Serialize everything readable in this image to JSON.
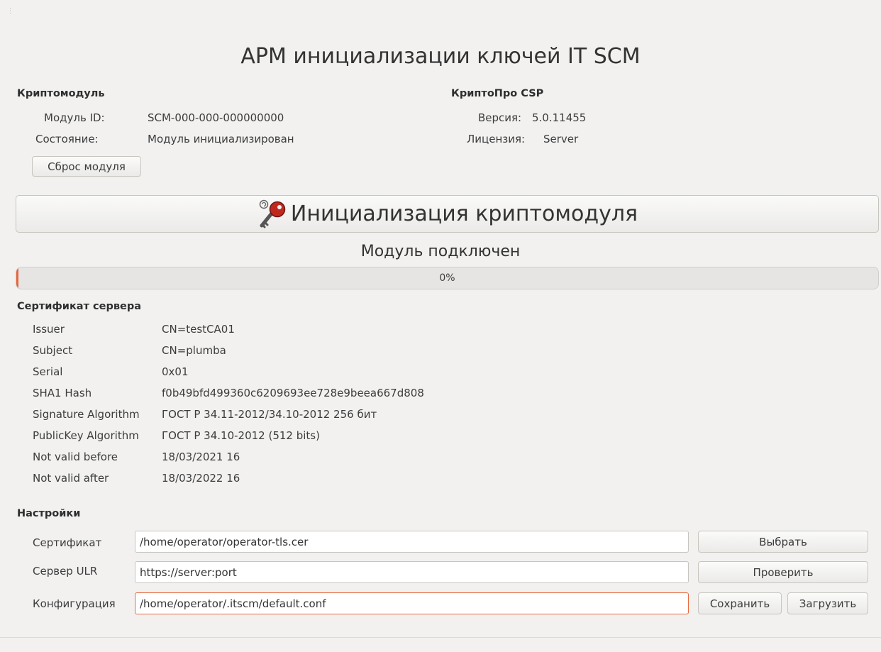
{
  "app": {
    "title": "АРМ инициализации ключей IT SCM"
  },
  "cryptomodule": {
    "heading": "Криптомодуль",
    "module_id_label": "Модуль ID:",
    "module_id_value": "SCM-000-000-000000000",
    "state_label": "Состояние:",
    "state_value": "Модуль инициализирован",
    "reset_button": "Сброс модуля"
  },
  "cryptopro": {
    "heading": "КриптоПро CSP",
    "version_label": "Версия:",
    "version_value": "5.0.11455",
    "license_label": "Лицензия:",
    "license_value": "Server"
  },
  "init": {
    "button_label": "Инициализация криптомодуля",
    "icon": "key-icon",
    "status": "Модуль подключен",
    "progress_value": 0,
    "progress_text": "0%",
    "progress_color": "#e8643c"
  },
  "certificate": {
    "heading": "Сертификат сервера",
    "rows": [
      {
        "label": "Issuer",
        "value": "CN=testCA01"
      },
      {
        "label": "Subject",
        "value": "CN=plumba"
      },
      {
        "label": "Serial",
        "value": "0x01"
      },
      {
        "label": "SHA1 Hash",
        "value": "f0b49bfd499360c6209693ee728e9beea667d808"
      },
      {
        "label": "Signature Algorithm",
        "value": "ГОСТ Р 34.11-2012/34.10-2012 256 бит"
      },
      {
        "label": "PublicKey Algorithm",
        "value": "ГОСТ Р 34.10-2012 (512 bits)"
      },
      {
        "label": "Not valid before",
        "value": "18/03/2021  16"
      },
      {
        "label": "Not valid after",
        "value": "18/03/2022  16"
      }
    ]
  },
  "settings": {
    "heading": "Настройки",
    "certificate_label": "Сертификат",
    "certificate_value": "/home/operator/operator-tls.cer",
    "choose_button": "Выбрать",
    "server_label": "Сервер ULR",
    "server_value": "https://server:port",
    "check_button": "Проверить",
    "config_label": "Конфигурация",
    "config_value": "/home/operator/.itscm/default.conf",
    "save_button": "Сохранить",
    "load_button": "Загрузить"
  }
}
